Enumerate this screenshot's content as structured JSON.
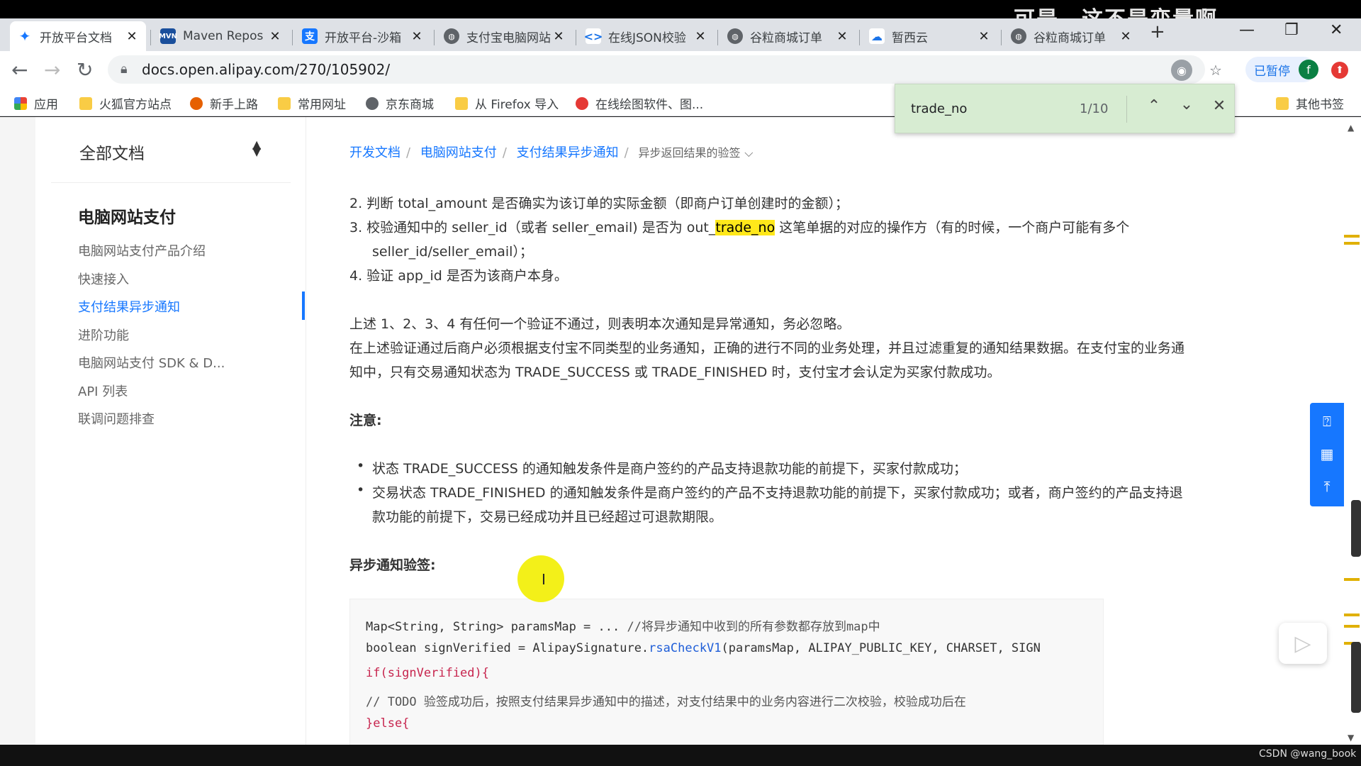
{
  "overlay_caption": "可是，这不是变量啊",
  "tabs": [
    {
      "title": "开放平台文档",
      "icon": "alipay-open-icon",
      "active": true
    },
    {
      "title": "Maven Repos",
      "icon": "mvn-icon",
      "active": false
    },
    {
      "title": "开放平台-沙箱",
      "icon": "alipay-icon",
      "active": false
    },
    {
      "title": "支付宝电脑网站",
      "icon": "globe-icon",
      "active": false
    },
    {
      "title": "在线JSON校验",
      "icon": "code-icon",
      "active": false
    },
    {
      "title": "谷粒商城订单",
      "icon": "globe-icon",
      "active": false
    },
    {
      "title": "暂西云",
      "icon": "cloud-icon",
      "active": false
    },
    {
      "title": "谷粒商城订单",
      "icon": "globe-icon",
      "active": false
    }
  ],
  "tab_close": "✕",
  "new_tab": "+",
  "window_controls": {
    "minimize": "—",
    "restore": "❐",
    "close": "✕"
  },
  "toolbar": {
    "url": "docs.open.alipay.com/270/105902/",
    "paused_label": "已暂停",
    "avatar_letter": "f"
  },
  "bookmarks": [
    "应用",
    "火狐官方站点",
    "新手上路",
    "常用网址",
    "京东商城",
    "从 Firefox 导入",
    "在线绘图软件、图...",
    "其他书签"
  ],
  "find": {
    "query": "trade_no",
    "count": "1/10"
  },
  "sidebar": {
    "select_label": "全部文档",
    "heading": "电脑网站支付",
    "items": [
      {
        "label": "电脑网站支付产品介绍"
      },
      {
        "label": "快速接入"
      },
      {
        "label": "支付结果异步通知"
      },
      {
        "label": "进阶功能"
      },
      {
        "label": "电脑网站支付 SDK & D..."
      },
      {
        "label": "API 列表"
      },
      {
        "label": "联调问题排查"
      }
    ]
  },
  "breadcrumb": {
    "items": [
      "开发文档",
      "电脑网站支付",
      "支付结果异步通知"
    ],
    "current": "异步返回结果的验签"
  },
  "content": {
    "line2": "2. 判断 total_amount 是否确实为该订单的实际金额（即商户订单创建时的金额）；",
    "line3_pre": "3. 校验通知中的 seller_id（或者 seller_email) 是否为 out_",
    "line3_hl": "trade_no",
    "line3_post": " 这笔单据的对应的操作方（有的时候，一个商户可能有多个",
    "line3b": "seller_id/seller_email）；",
    "line4": "4. 验证 app_id 是否为该商户本身。",
    "para1": "上述 1、2、3、4 有任何一个验证不通过，则表明本次通知是异常通知，务必忽略。",
    "para2a": "在上述验证通过后商户必须根据支付宝不同类型的业务通知，正确的进行不同的业务处理，并且过滤重复的通知结果数据。在支付宝的业务通",
    "para2b": "知中，只有交易通知状态为 TRADE_SUCCESS 或 TRADE_FINISHED 时，支付宝才会认定为买家付款成功。",
    "note_heading": "注意:",
    "bullet1": "状态 TRADE_SUCCESS 的通知触发条件是商户签约的产品支持退款功能的前提下，买家付款成功；",
    "bullet2a": "交易状态 TRADE_FINISHED 的通知触发条件是商户签约的产品不支持退款功能的前提下，买家付款成功；或者，商户签约的产品支持退",
    "bullet2b": "款功能的前提下，交易已经成功并且已经超过可退款期限。",
    "verify_heading": "异步通知验签:",
    "code": {
      "l1a": "Map<String, String> paramsMap = ... ",
      "l1b": "//将异步通知中收到的所有参数都存放到map中",
      "l2a": "boolean signVerified = AlipaySignature.",
      "l2b": "rsaCheckV1",
      "l2c": "(paramsMap, ALIPAY_PUBLIC_KEY, CHARSET, SIGN",
      "l3": "if(signVerified){",
      "l4": "    // TODO 验签成功后，按照支付结果异步通知中的描述，对支付结果中的业务内容进行二次校验，校验成功后在",
      "l5": "}else{"
    }
  },
  "watermark": "CSDN @wang_book",
  "colors": {
    "link": "#1677ff",
    "highlight": "#ffe81a",
    "findbar": "#d7ecd2"
  }
}
